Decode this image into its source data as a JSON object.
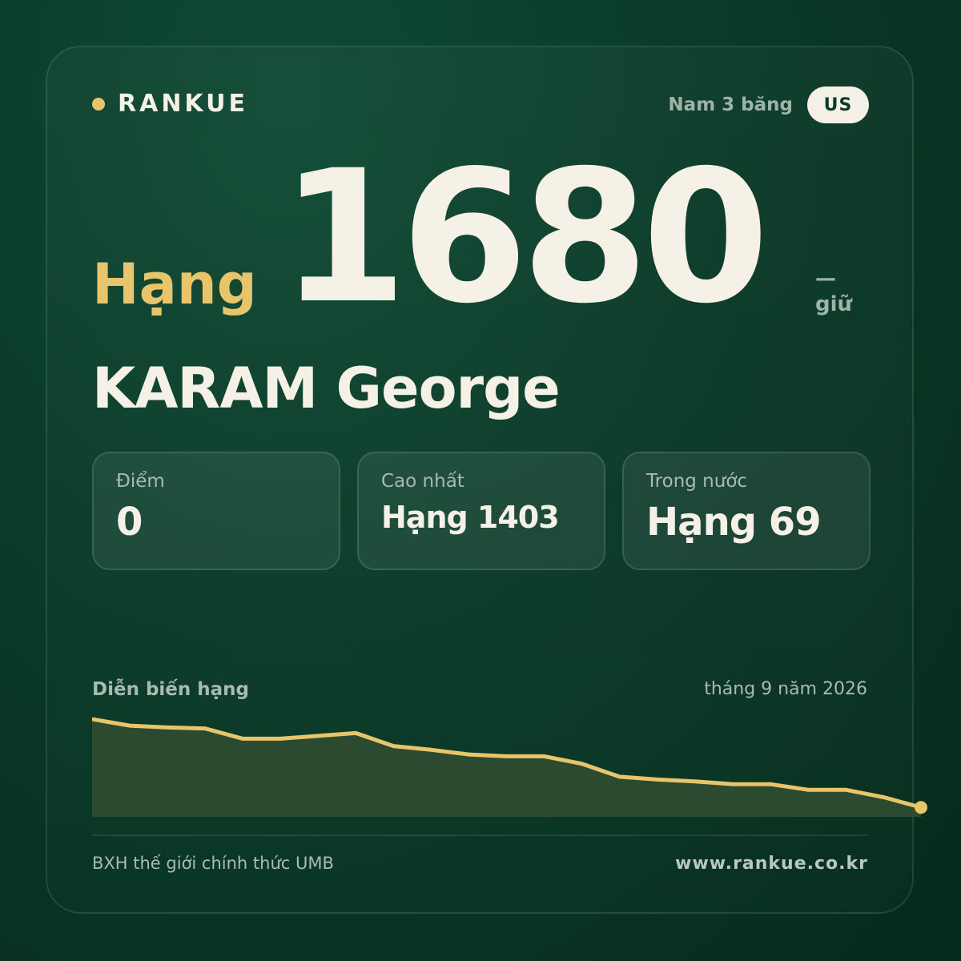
{
  "brand": {
    "name": "RANKUE",
    "dot_color": "#e8c56a"
  },
  "header": {
    "category": "Nam 3 băng",
    "country_code": "US"
  },
  "rank": {
    "label": "Hạng",
    "value": "1680",
    "change_symbol": "—",
    "change_text": "giữ"
  },
  "player": {
    "name": "KARAM George"
  },
  "stats": [
    {
      "label": "Điểm",
      "value": "0"
    },
    {
      "label": "Cao nhất",
      "value": "Hạng 1403"
    },
    {
      "label": "Trong nước",
      "value": "Hạng 69"
    }
  ],
  "chart": {
    "title": "Diễn biến hạng",
    "date": "tháng 9 năm 2026"
  },
  "chart_data": {
    "type": "area",
    "x": [
      0,
      1,
      2,
      3,
      4,
      5,
      6,
      7,
      8,
      9,
      10,
      11,
      12,
      13,
      14,
      15,
      16,
      17,
      18,
      19,
      20,
      21,
      22
    ],
    "values": [
      0.0,
      0.07,
      0.09,
      0.1,
      0.21,
      0.21,
      0.18,
      0.15,
      0.29,
      0.33,
      0.38,
      0.4,
      0.4,
      0.48,
      0.62,
      0.65,
      0.67,
      0.7,
      0.7,
      0.76,
      0.76,
      0.84,
      0.95
    ],
    "end_value": 0.95,
    "line_color": "#e8c56a",
    "fill_color": "#2c4a2f"
  },
  "footer": {
    "source": "BXH thế giới chính thức UMB",
    "url": "www.rankue.co.kr"
  }
}
